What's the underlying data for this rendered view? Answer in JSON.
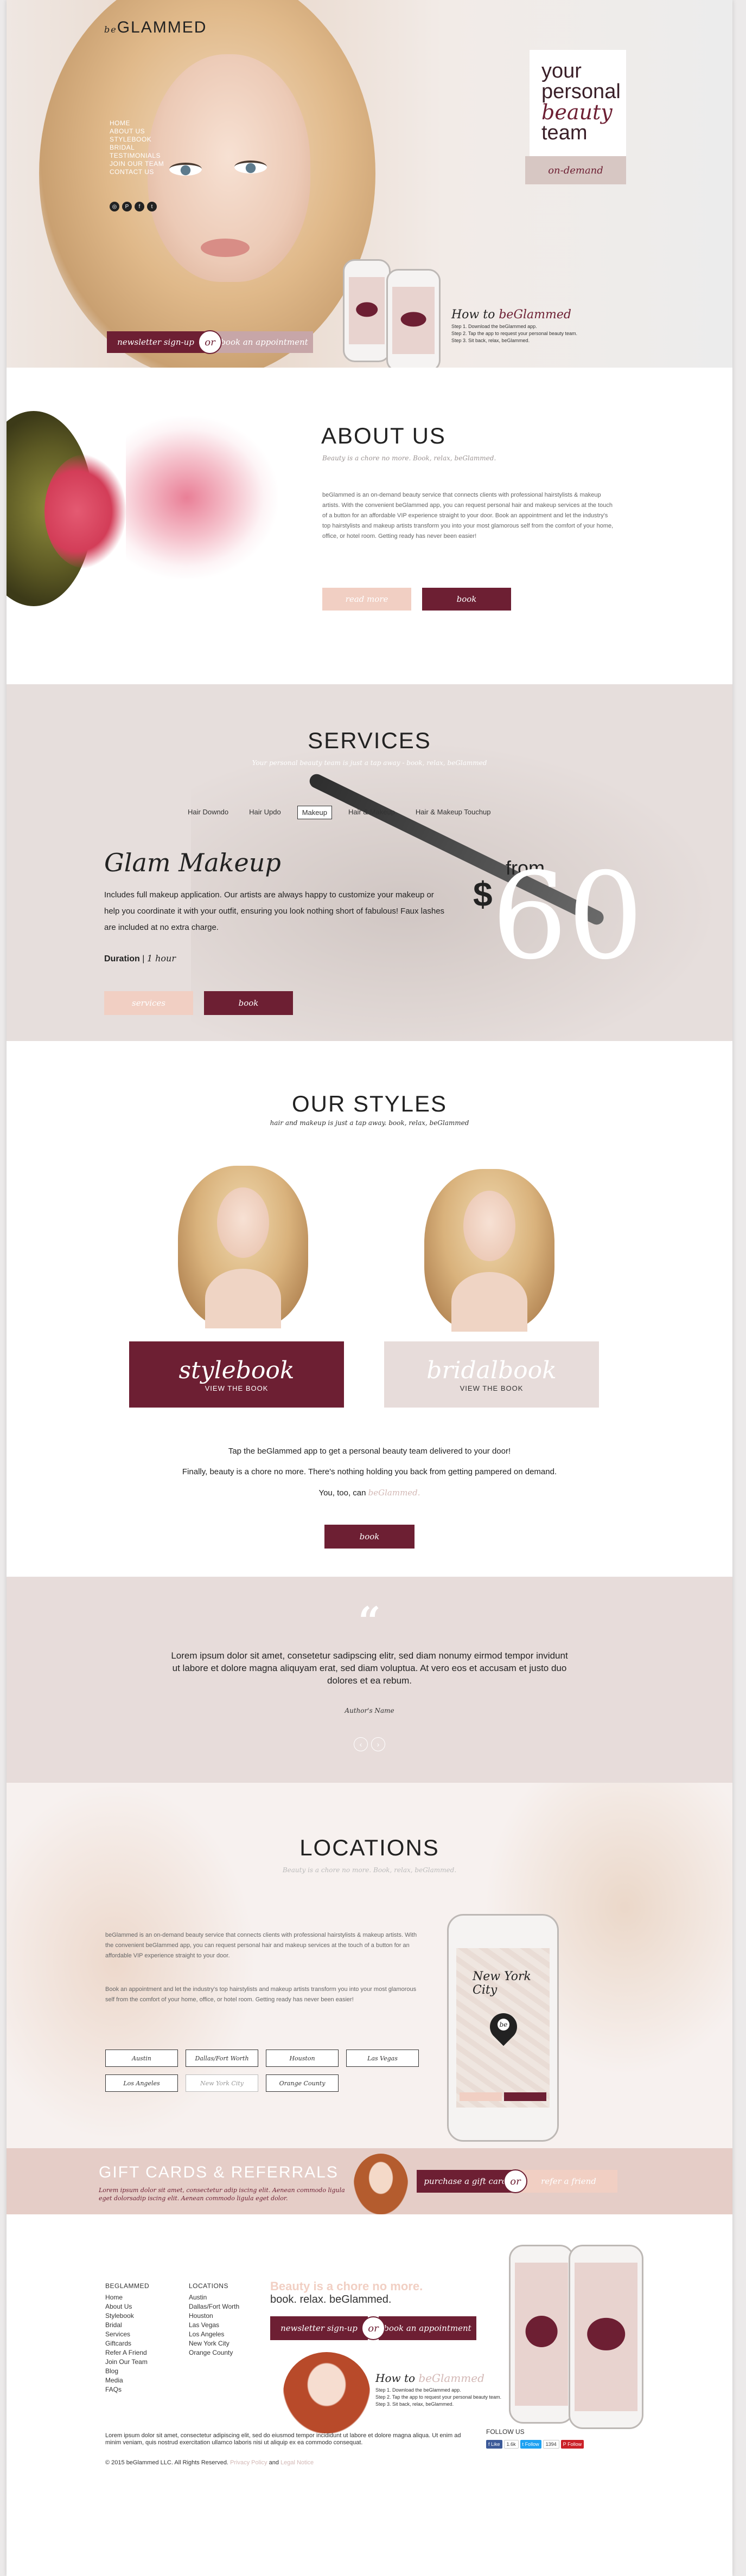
{
  "brand": {
    "logo_script": "be",
    "logo_text": "GLAMMED"
  },
  "colors": {
    "maroon": "#6d1f33",
    "pink": "#f1cfc3",
    "blush": "#e7dcda"
  },
  "hero": {
    "nav": [
      "HOME",
      "ABOUT US",
      "STYLEBOOK",
      "BRIDAL",
      "TESTIMONIALS",
      "JOIN OUR TEAM",
      "CONTACT US"
    ],
    "social_icons": [
      "instagram-icon",
      "pinterest-icon",
      "facebook-icon",
      "twitter-icon"
    ],
    "tagline_line1": "your",
    "tagline_line2": "personal",
    "tagline_line3": "beauty",
    "tagline_line4": "team",
    "ondemand": "on-demand",
    "howto_prefix": "How to ",
    "howto_brand": "beGlammed",
    "steps": [
      "Step 1. Download the beGlammed app.",
      "Step 2. Tap the app to request your personal beauty team.",
      "Step 3. Sit back, relax, beGlammed."
    ],
    "newsletter_label": "newsletter sign-up",
    "or": "or",
    "appt_label": "book an appointment"
  },
  "about": {
    "title": "ABOUT US",
    "subtitle": "Beauty is a chore no more. Book, relax, beGlammed.",
    "body": "beGlammed is an on-demand beauty service that connects clients with professional hairstylists & makeup artists. With the convenient beGlammed app, you can request personal hair and makeup services at the touch of a button for an affordable VIP experience straight to your door. Book an appointment and let the industry's top hairstylists and makeup artists transform you into your most glamorous self from the comfort of your home, office, or hotel room. Getting ready has never been easier!",
    "read_more": "read more",
    "book": "book"
  },
  "services": {
    "title": "SERVICES",
    "subtitle": "Your personal beauty team is just a tap away - book, relax, beGlammed",
    "tabs": [
      "Hair Downdo",
      "Hair Updo",
      "Makeup",
      "Hair & Makeup",
      "Hair & Makeup Touchup"
    ],
    "active_tab": "Makeup",
    "heading": "Glam Makeup",
    "desc": "Includes full makeup application. Our artists are always happy to customize your makeup or help you coordinate it with your outfit, ensuring you look nothing short of fabulous! Faux lashes are included at no extra charge.",
    "duration_label": "Duration",
    "duration_value": "1 hour",
    "from": "from",
    "currency": "$",
    "price": "60",
    "services_btn": "services",
    "book_btn": "book"
  },
  "styles": {
    "title": "OUR STYLES",
    "subtitle": "hair and makeup is just a tap away. book, relax, beGlammed",
    "stylebook_title": "stylebook",
    "stylebook_sub": "VIEW THE BOOK",
    "bridal_title": "bridalbook",
    "bridal_sub": "VIEW THE BOOK",
    "line1": "Tap the beGlammed app to get a personal beauty team delivered to your door!",
    "line2": "Finally, beauty is a chore no more. There's nothing holding you back from getting pampered on demand.",
    "line3_prefix": "You, too, can ",
    "line3_link": "beGlammed.",
    "book": "book"
  },
  "testimonial": {
    "quote_mark": "“",
    "text": "Lorem ipsum dolor sit amet, consetetur sadipscing elitr, sed diam nonumy eirmod tempor invidunt ut labore et dolore magna aliquyam erat, sed diam voluptua. At vero eos et accusam et justo duo dolores et ea rebum.",
    "author": "Author's Name",
    "prev": "‹",
    "next": "›"
  },
  "locations": {
    "title": "LOCATIONS",
    "subtitle": "Beauty is a chore no more. Book, relax, beGlammed.",
    "body1": "beGlammed is an on-demand beauty service that connects clients with professional hairstylists & makeup artists. With the convenient beGlammed app, you can request personal hair and makeup services at the touch of a button for an affordable VIP experience straight to your door.",
    "body2": "Book an appointment and let the industry's top hairstylists and makeup artists transform you into your most glamorous self from the comfort of your home, office, or hotel room. Getting ready has never been easier!",
    "cities_row1": [
      "Austin",
      "Dallas/Fort Worth",
      "Houston",
      "Las Vegas"
    ],
    "cities_row2": [
      "Los Angeles",
      "New York City",
      "Orange County"
    ],
    "phone_city": "New York City",
    "phone_pin": "be"
  },
  "gift": {
    "title": "GIFT CARDS & REFERRALS",
    "text": "Lorem ipsum dolor sit amet, consectetur adip iscing elit. Aenean commodo ligula eget dolorsadip iscing elit. Aenean commodo ligula eget dolor.",
    "purchase": "purchase a gift card",
    "or": "or",
    "refer": "refer a friend"
  },
  "footer": {
    "col1_head": "BEGLAMMED",
    "col1": [
      "Home",
      "About Us",
      "Stylebook",
      "Bridal",
      "Services",
      "Giftcards",
      "Refer A Friend",
      "Join Our Team",
      "Blog",
      "Media",
      "FAQs"
    ],
    "col2_head": "LOCATIONS",
    "col2": [
      "Austin",
      "Dallas/Fort Worth",
      "Houston",
      "Las Vegas",
      "Los Angeles",
      "New York City",
      "Orange County"
    ],
    "promo_head": "Beauty is a chore no more.",
    "promo_sub": "book. relax. beGlammed.",
    "newsletter": "newsletter sign-up",
    "or": "or",
    "appt": "book an appointment",
    "howto_prefix": "How to ",
    "howto_brand": "beGlammed",
    "steps": [
      "Step 1. Download the beGlammed app.",
      "Step 2. Tap the app to request your personal beauty team.",
      "Step 3. Sit back, relax, beGlammed."
    ],
    "legal_text": "Lorem ipsum dolor sit amet, consectetur adipiscing elit, sed do eiusmod tempor incididunt ut labore et dolore magna aliqua. Ut enim ad minim veniam, quis nostrud exercitation ullamco laboris nisi ut aliquip ex ea commodo consequat.",
    "copyright": "© 2015 beGlammed LLC. All Rights Reserved.",
    "privacy": "Privacy Policy",
    "and": "and",
    "legal": "Legal Notice",
    "follow": "FOLLOW US",
    "social_like": "Like",
    "social_like_count": "1.6k",
    "social_follow": "Follow",
    "social_follow_count": "1394",
    "social_pin": "Follow"
  }
}
